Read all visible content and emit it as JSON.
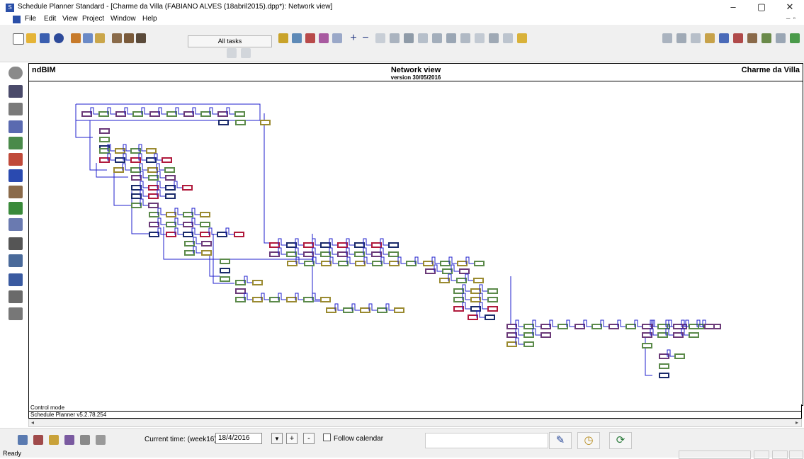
{
  "window": {
    "title": "Schedule Planner Standard - [Charme da Villa (FABIANO ALVES (18abril2015).dpp*): Network view]",
    "minimize": "–",
    "maximize": "▢",
    "close": "✕"
  },
  "menu": [
    "File",
    "Edit",
    "View",
    "Project",
    "Window",
    "Help"
  ],
  "toolbar": {
    "task_filter": "All tasks"
  },
  "network_view": {
    "left_header": "ndBIM",
    "title": "Network view",
    "version": "version 30/05/2016",
    "right_header": "Charme da Villa"
  },
  "info": {
    "mode": "Control mode",
    "version": "Schedule Planner v5.2.78.254"
  },
  "bottom_bar": {
    "current_time_label": "Current time: (week16)",
    "current_time_value": "18/4/2016",
    "plus_label": "+",
    "minus_label": "-",
    "follow_calendar_label": "Follow calendar"
  },
  "status": {
    "text": "Ready"
  },
  "colors": {
    "link": "#1f1fcc",
    "box_green": "#5b8a4a",
    "box_red": "#b01a3c",
    "box_purple": "#6b3a78",
    "box_olive": "#9a8a30",
    "box_dark": "#1a2a6a"
  }
}
